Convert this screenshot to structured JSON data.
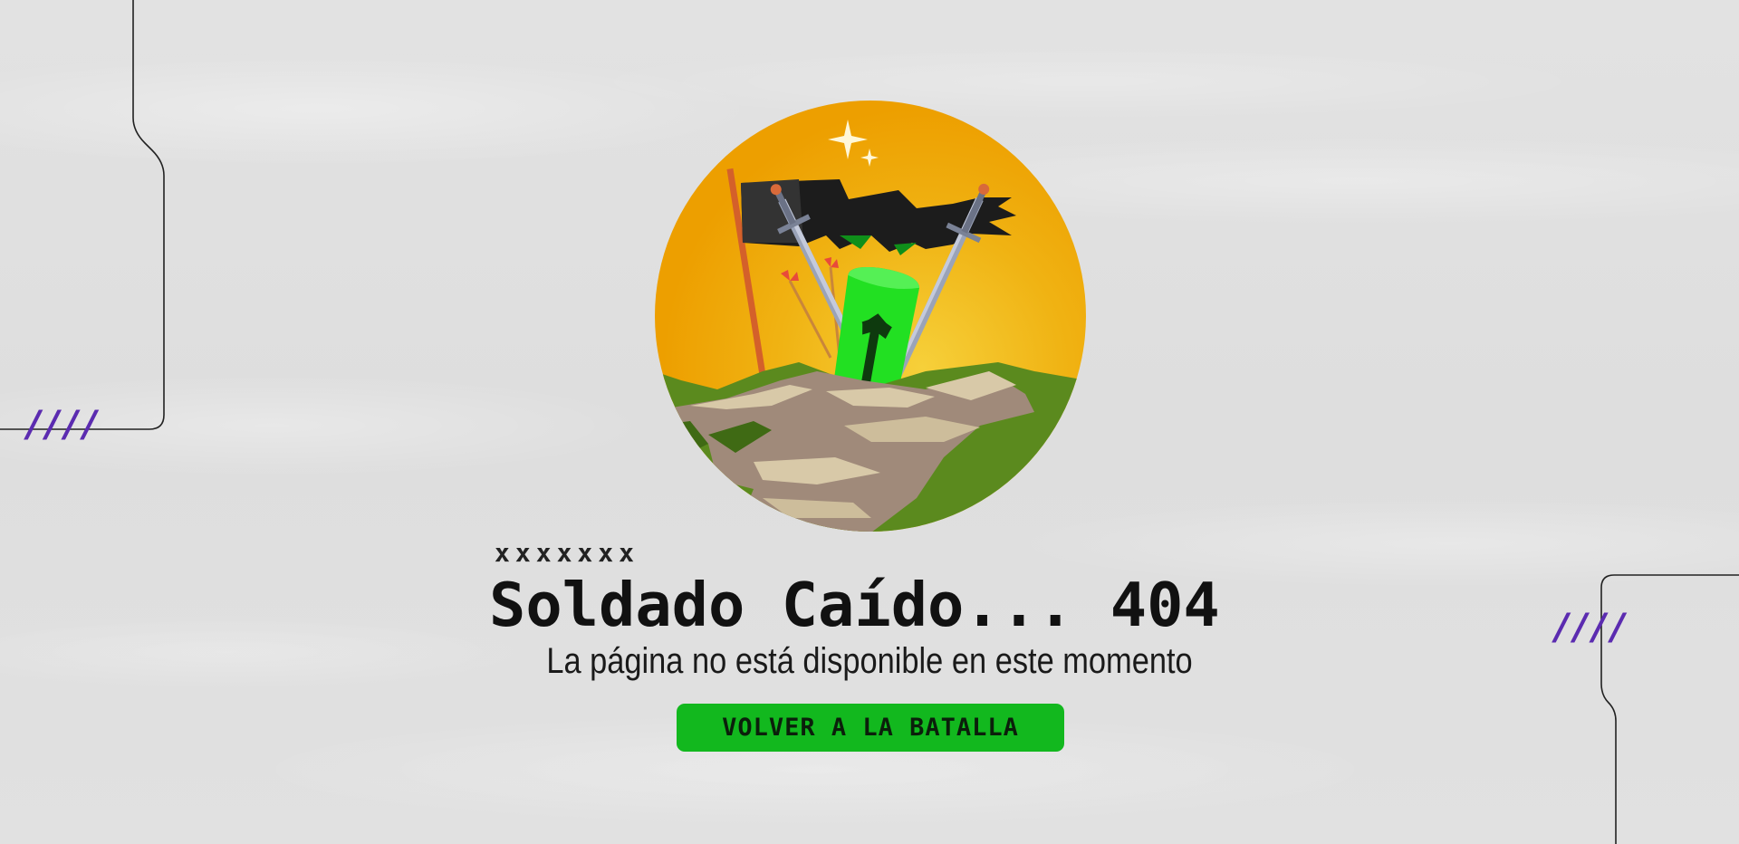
{
  "decor": {
    "left_slashes": "////",
    "right_slashes": "////",
    "accent_color": "#5b2bb0"
  },
  "emblem": {
    "icon": "fallen-soldier-helmet-swords-flag-icon",
    "sun_color": "#f0a000",
    "helmet_color": "#22e022"
  },
  "content": {
    "eyebrow": "xxxxxxx",
    "title": "Soldado Caído... 404",
    "subtitle": "La página no está disponible en este momento",
    "cta_label": "VOLVER A LA BATALLA",
    "cta_color": "#12b81e"
  }
}
